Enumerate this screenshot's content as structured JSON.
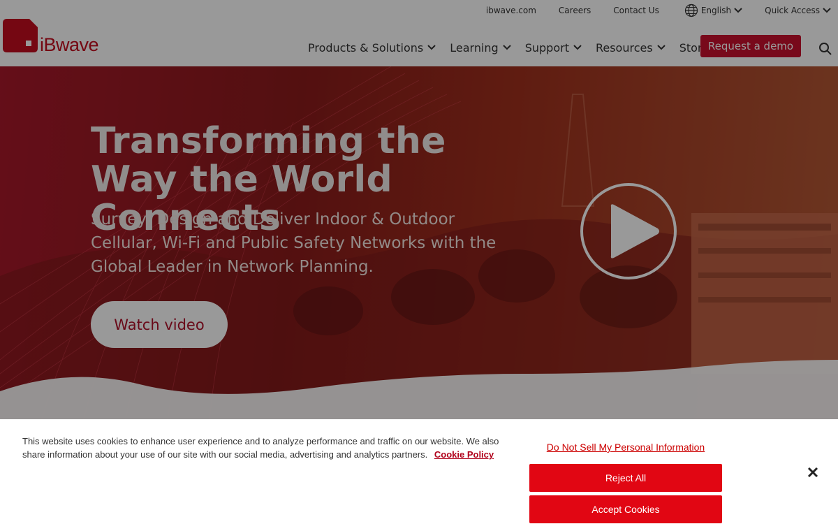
{
  "brand": {
    "name": "iBwave",
    "accent": "#c8102e"
  },
  "utility_nav": {
    "items": [
      {
        "label": "ibwave.com"
      },
      {
        "label": "Careers"
      },
      {
        "label": "Contact Us"
      },
      {
        "label": "English",
        "icon": "globe-icon",
        "dropdown": true
      },
      {
        "label": "Quick Access",
        "dropdown": true
      }
    ]
  },
  "main_nav": {
    "items": [
      {
        "label": "Products & Solutions",
        "dropdown": true
      },
      {
        "label": "Learning",
        "dropdown": true
      },
      {
        "label": "Support",
        "dropdown": true
      },
      {
        "label": "Resources",
        "dropdown": true
      },
      {
        "label": "Store",
        "dropdown": false
      }
    ],
    "cta": "Request a demo",
    "search_icon": "search-icon"
  },
  "hero": {
    "title": "Transforming the Way the World Connects",
    "subtitle": "Survey, Design and Deliver Indoor & Outdoor Cellular, Wi-Fi and Public Safety Networks with the Global Leader in Network Planning.",
    "watch_button": "Watch video",
    "play_icon": "play-icon"
  },
  "cookie_banner": {
    "text": "This website uses cookies to enhance user experience and to analyze performance and traffic on our website. We also share information about your use of our site with our social media, advertising and analytics partners.",
    "policy_link": "Cookie Policy",
    "do_not_sell": "Do Not Sell My Personal Information",
    "reject": "Reject All",
    "accept": "Accept Cookies",
    "close_icon": "close-icon"
  }
}
